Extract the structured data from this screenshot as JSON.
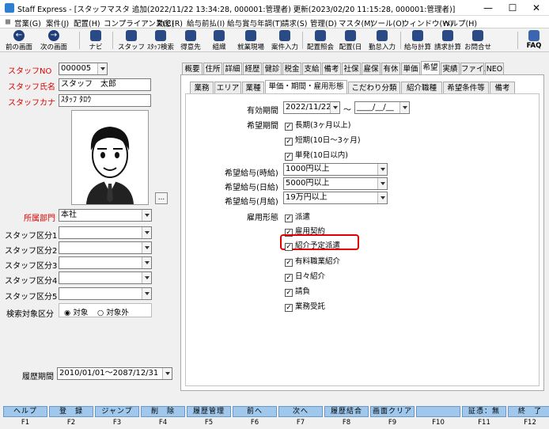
{
  "window": {
    "title": "Staff Express - [スタッフマスタ 追加(2022/11/22 13:34:28, 000001:管理者) 更新(2023/02/20 11:15:28, 000001:管理者)]",
    "minimize": "—",
    "maximize": "☐",
    "close": "✕"
  },
  "menu": [
    "営業(G)",
    "案件(J)",
    "配置(H)",
    "コンプライアンス(C)",
    "勤怠(R)",
    "給与前払(I)",
    "給与賞与年調(T)",
    "請求(S)",
    "管理(D)",
    "マスタ(M)",
    "ツール(O)",
    "ウィンドウ(W)",
    "ヘルプ(H)"
  ],
  "toolbar": {
    "prev": "前の画面",
    "next": "次の画面",
    "navi": "ナビ",
    "staff": "スタッフ",
    "staff_search": "ｽﾀｯﾌ検索",
    "client": "得意先",
    "org": "組織",
    "site": "就業現場",
    "staff_entry": "案件入力",
    "assign_meeting": "配置照会",
    "assign_day": "配置(日",
    "attendance": "勤怠入力",
    "pay_calc": "給与計算",
    "bill_calc": "請求計算",
    "inquiry": "お問合せ",
    "faq": "FAQ"
  },
  "left": {
    "staff_no_label": "スタッフNO",
    "staff_no": "000005",
    "name_label": "スタッフ氏名",
    "name": "スタッフ　太郎",
    "kana_label": "スタッフカナ",
    "kana": "ｽﾀｯﾌ ﾀﾛｳ",
    "photo_button": "...",
    "dept_label": "所属部門",
    "dept": "本社",
    "class1_label": "スタッフ区分1",
    "class2_label": "スタッフ区分2",
    "class3_label": "スタッフ区分3",
    "class4_label": "スタッフ区分4",
    "class5_label": "スタッフ区分5",
    "search_label": "検索対象区分",
    "search_target": "対象",
    "search_excluded": "対象外",
    "history_label": "履歴期間",
    "history_period": "2010/01/01～2087/12/31"
  },
  "tabs_top": [
    "概要",
    "住所",
    "詳細",
    "経歴",
    "健診",
    "税金",
    "支給",
    "備考",
    "社保",
    "雇保",
    "有休",
    "単価",
    "希望",
    "実績",
    "ファイル",
    "NEO"
  ],
  "tabs_sub": [
    "業務",
    "エリア",
    "業種",
    "単価・期間・雇用形態",
    "こだわり分類",
    "紹介職種",
    "希望条件等",
    "備考"
  ],
  "form": {
    "period_label": "有効期間",
    "period_from": "2022/11/22",
    "period_sep": "～",
    "period_to": "____/__/__",
    "wish_period_label": "希望期間",
    "long": "長期(3ヶ月以上)",
    "short": "短期(10日～3ヶ月)",
    "single": "単発(10日以内)",
    "hourly_label": "希望給与(時給)",
    "hourly": "1000円以上",
    "daily_label": "希望給与(日給)",
    "daily": "5000円以上",
    "monthly_label": "希望給与(月給)",
    "monthly": "19万円以上",
    "employment_label": "雇用形態",
    "emp": [
      "派遣",
      "雇用契約",
      "紹介予定派遣",
      "有料職業紹介",
      "日々紹介",
      "請負",
      "業務受託"
    ]
  },
  "fkeys": [
    {
      "label": "ヘルプ",
      "key": "F1"
    },
    {
      "label": "登　録",
      "key": "F2"
    },
    {
      "label": "ジャンプ",
      "key": "F3"
    },
    {
      "label": "削　除",
      "key": "F4"
    },
    {
      "label": "履歴管理",
      "key": "F5"
    },
    {
      "label": "前へ",
      "key": "F6"
    },
    {
      "label": "次へ",
      "key": "F7"
    },
    {
      "label": "履歴結合",
      "key": "F8"
    },
    {
      "label": "画面クリア",
      "key": "F9"
    },
    {
      "label": "",
      "key": "F10"
    },
    {
      "label": "証憑：無",
      "key": "F11"
    },
    {
      "label": "終　了",
      "key": "F12"
    }
  ],
  "colors": {
    "highlight": "#e00000",
    "fkey": "#9fc8ec"
  }
}
